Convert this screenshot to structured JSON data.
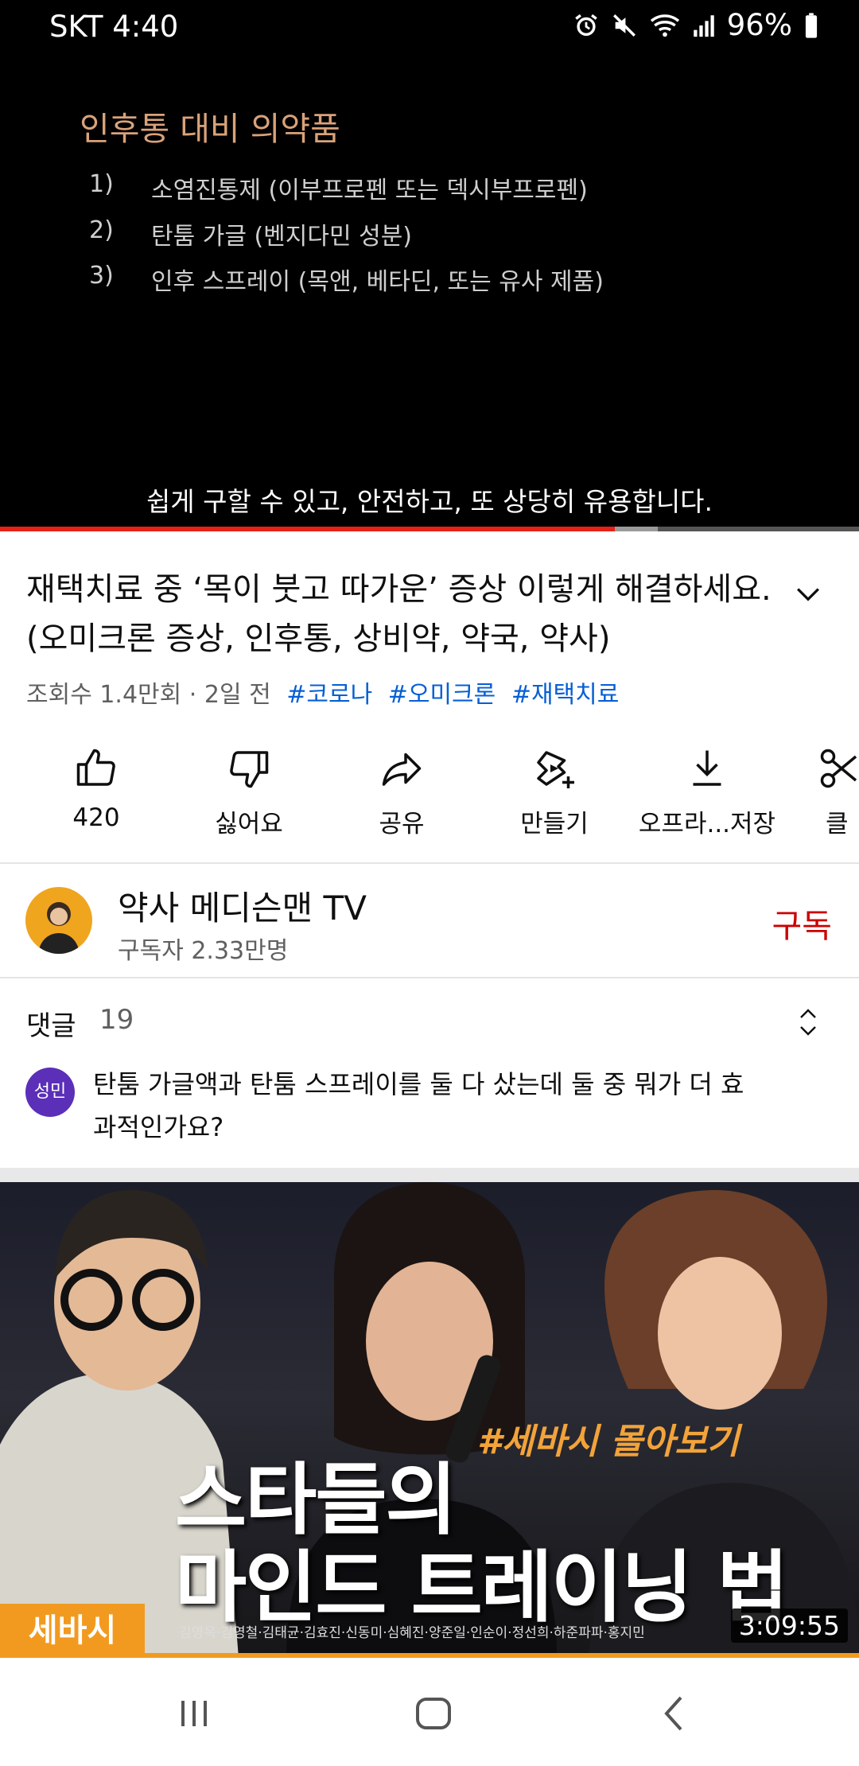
{
  "status_bar": {
    "carrier_time": "SKT 4:40",
    "battery": "96%",
    "icons": [
      "alarm-icon",
      "mute-icon",
      "wifi-icon",
      "signal-icon",
      "battery-icon"
    ]
  },
  "video": {
    "slide_title": "인후통 대비 의약품",
    "slide_items": [
      {
        "num": "1)",
        "text": "소염진통제 (이부프로펜 또는 덱시부프로펜)"
      },
      {
        "num": "2)",
        "text": "탄툼 가글 (벤지다민 성분)"
      },
      {
        "num": "3)",
        "text": "인후 스프레이 (목앤, 베타딘, 또는 유사 제품)"
      }
    ],
    "subtitle": "쉽게 구할 수 있고, 안전하고, 또 상당히 유용합니다.",
    "progress_played": 0.716,
    "progress_buffered": 0.766,
    "colors": {
      "played": "#e62117",
      "slide_title": "#d9a27a"
    }
  },
  "info": {
    "title": "재택치료 중 ‘목이 붓고 따가운’ 증상 이렇게 해결하세요. (오미크론 증상, 인후통, 상비약, 약국, 약사)",
    "meta": "조회수 1.4만회 · 2일 전",
    "hashtags": [
      "#코로나",
      "#오미크론",
      "#재택치료"
    ]
  },
  "actions": {
    "like": "420",
    "dislike": "싫어요",
    "share": "공유",
    "create": "만들기",
    "offline": "오프라...저장",
    "clip": "클"
  },
  "channel": {
    "name": "약사 메디슨맨 TV",
    "subscribers": "구독자 2.33만명",
    "subscribe": "구독"
  },
  "comments": {
    "label": "댓글",
    "count": "19",
    "avatar_text": "성민",
    "top_comment": "탄툼 가글액과 탄툼 스프레이를 둘 다 샀는데 둘 중 뭐가 더 효과적인가요?"
  },
  "next_video": {
    "title_line1": "스타들의",
    "title_line2": "마인드 트레이닝 법",
    "hashtag": "#세바시 몰아보기",
    "brand": "세바시",
    "cast": "김영옥·김영철·김태균·김효진·신동미·심혜진·양준일·인순이·정선희·하준파파·홍지민",
    "duration": "3:09:55"
  },
  "nav": [
    "recents-icon",
    "home-icon",
    "back-icon"
  ]
}
